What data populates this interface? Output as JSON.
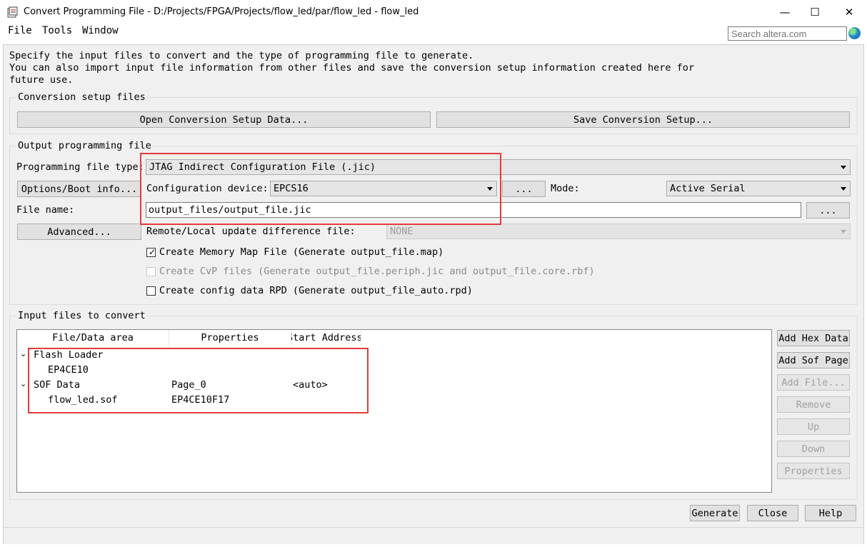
{
  "window": {
    "title": "Convert Programming File - D:/Projects/FPGA/Projects/flow_led/par/flow_led - flow_led",
    "minimize": "—",
    "maximize": "☐",
    "close": "✕"
  },
  "menu": {
    "file": "File",
    "tools": "Tools",
    "window": "Window"
  },
  "search": {
    "placeholder": "Search altera.com"
  },
  "description": {
    "line1": "Specify the input files to convert and the type of programming file to generate.",
    "line2": "You can also import input file information from other files and save the conversion setup information created here for",
    "line3": "future use."
  },
  "conversion_setup": {
    "label": "Conversion setup files",
    "open_button": "Open Conversion Setup Data...",
    "save_button": "Save Conversion Setup..."
  },
  "output": {
    "label": "Output programming file",
    "type_label": "Programming file type:",
    "type_value": "JTAG Indirect Configuration File (.jic)",
    "options_button": "Options/Boot info...",
    "config_device_label": "Configuration device:",
    "config_device_value": "EPCS16",
    "browse_device": "...",
    "mode_label": "Mode:",
    "mode_value": "Active Serial",
    "file_name_label": "File name:",
    "file_name_value": "output_files/output_file.jic",
    "browse_file": "...",
    "advanced_button": "Advanced...",
    "remote_label": "Remote/Local update difference file:",
    "remote_value": "NONE",
    "chk_memory_map": "Create Memory Map File (Generate output_file.map)",
    "chk_memory_map_checked": true,
    "chk_cvp": "Create CvP files (Generate output_file.periph.jic and output_file.core.rbf)",
    "chk_rpd": "Create config data RPD (Generate output_file_auto.rpd)"
  },
  "input": {
    "label": "Input files to convert",
    "columns": [
      "File/Data area",
      "Properties",
      "Start Address"
    ],
    "rows": [
      {
        "name": "Flash Loader",
        "properties": "",
        "address": ""
      },
      {
        "name": "EP4CE10",
        "properties": "",
        "address": ""
      },
      {
        "name": "SOF Data",
        "properties": "Page_0",
        "address": "<auto>"
      },
      {
        "name": "flow_led.sof",
        "properties": "EP4CE10F17",
        "address": ""
      }
    ],
    "buttons": {
      "add_hex": "Add Hex Data",
      "add_sof": "Add Sof Page",
      "add_file": "Add File...",
      "remove": "Remove",
      "up": "Up",
      "down": "Down",
      "properties": "Properties"
    }
  },
  "footer": {
    "generate": "Generate",
    "close": "Close",
    "help": "Help"
  },
  "colors": {
    "highlight_box": "#e53a3a",
    "dialog_bg": "#f0f0f0"
  }
}
